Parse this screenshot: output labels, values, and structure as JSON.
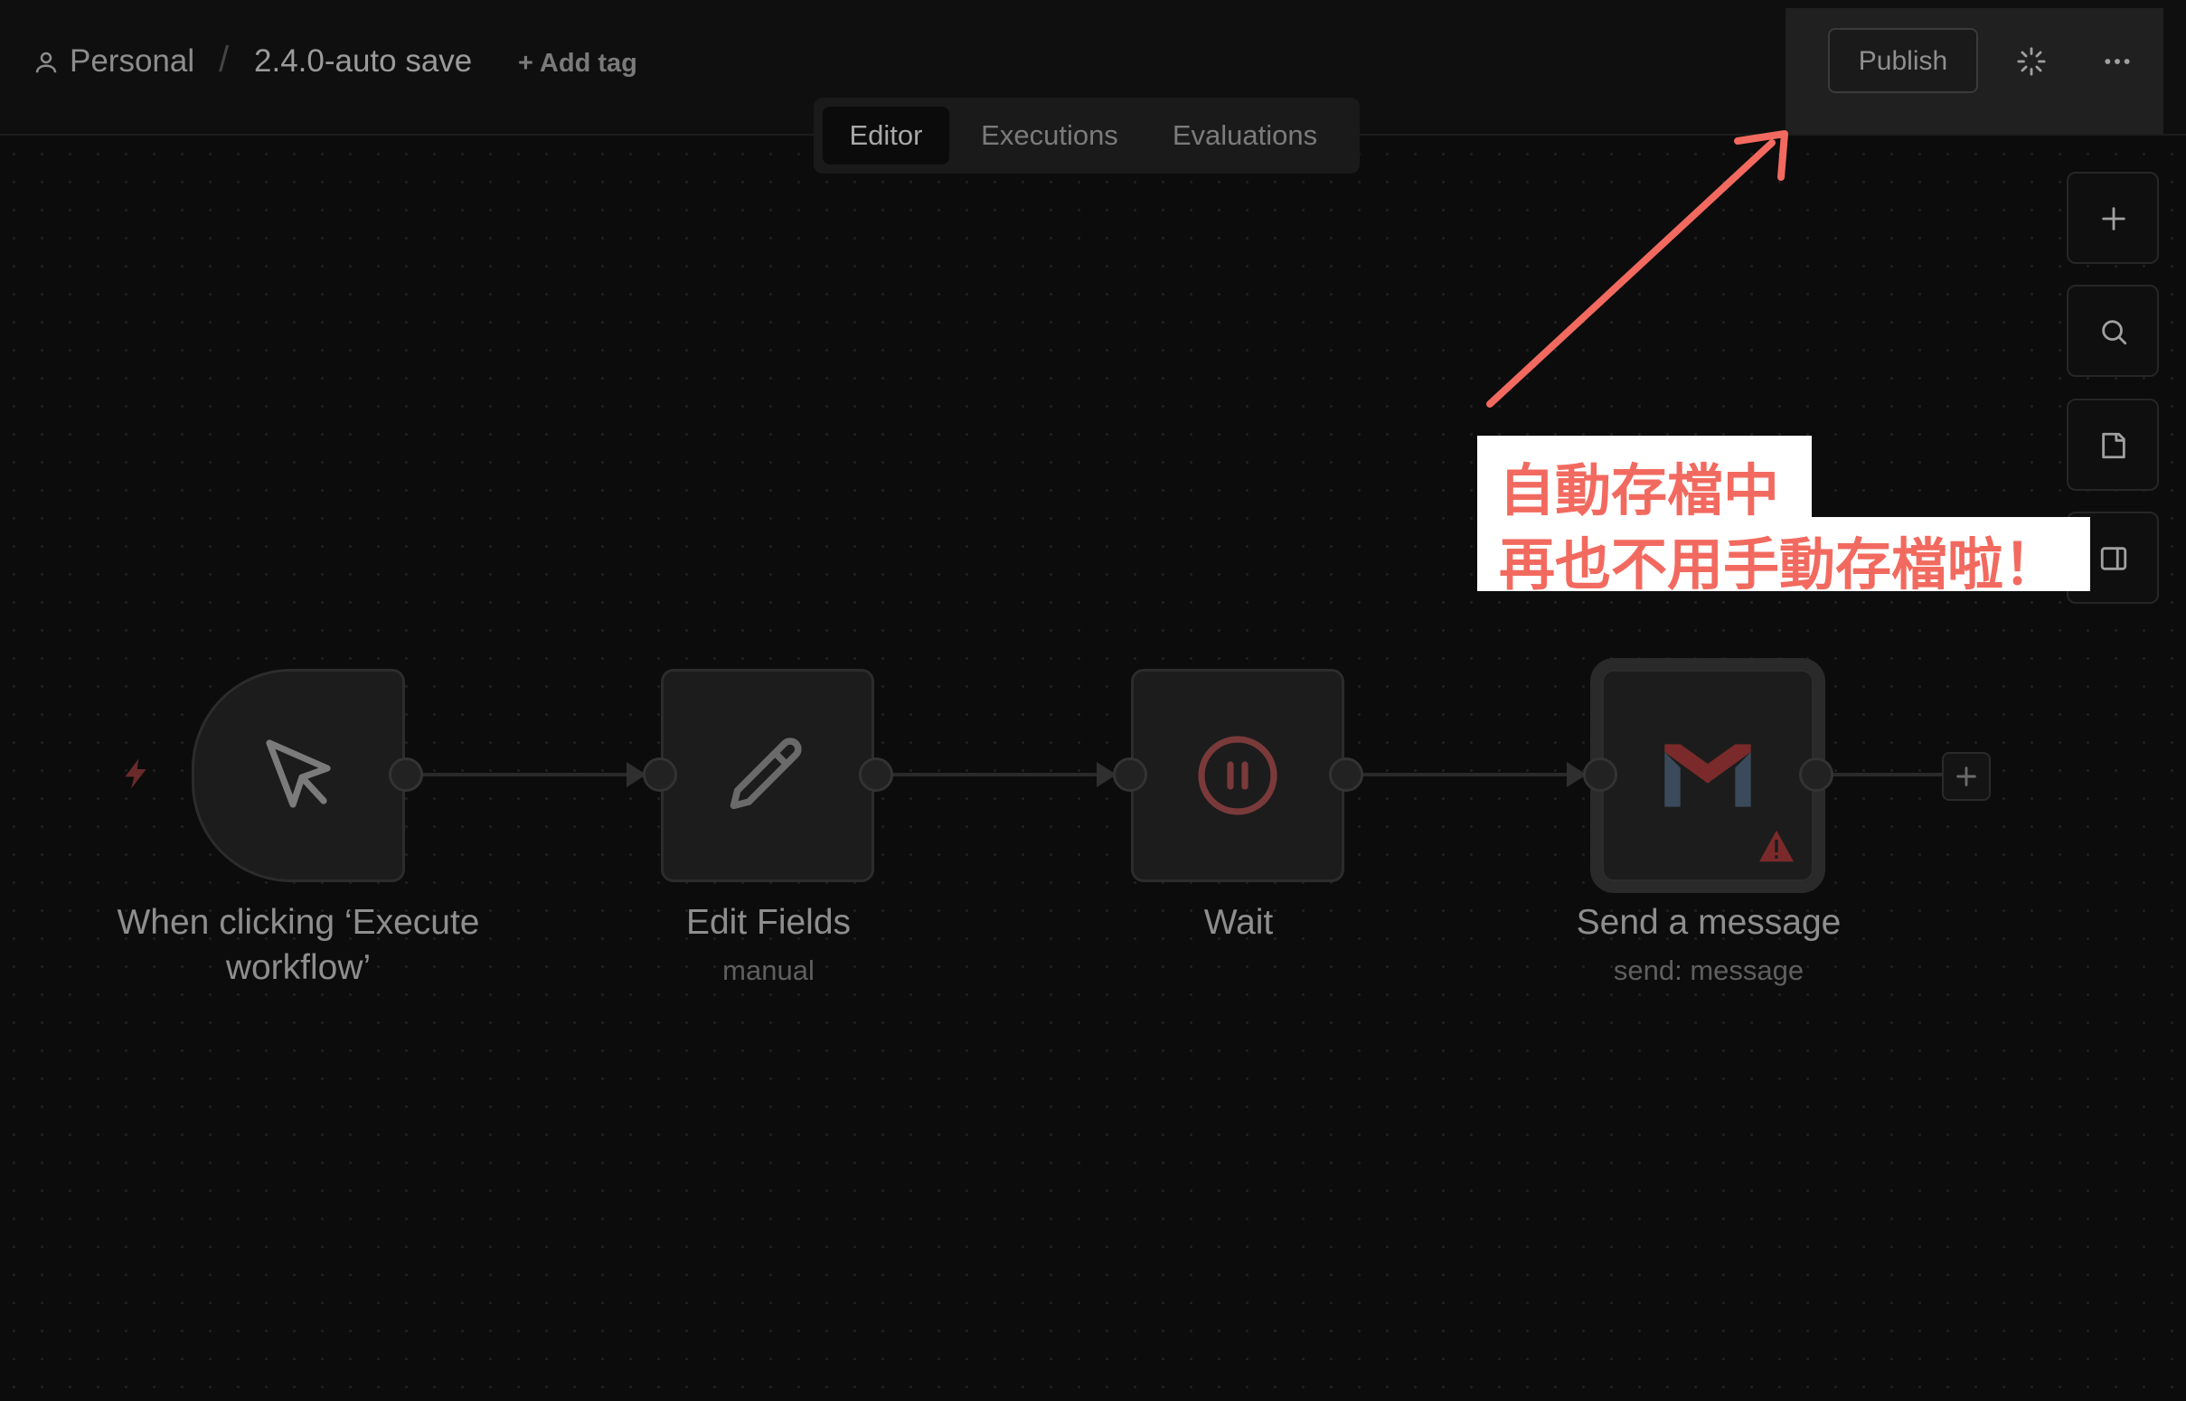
{
  "header": {
    "project": "Personal",
    "separator": "/",
    "workflow_name": "2.4.0-auto save",
    "add_tag": "+ Add tag",
    "publish_label": "Publish",
    "status_icon": "loading-spinner-icon",
    "more_icon": "ellipsis-icon"
  },
  "tabs": [
    {
      "label": "Editor",
      "active": true
    },
    {
      "label": "Executions",
      "active": false
    },
    {
      "label": "Evaluations",
      "active": false
    }
  ],
  "side_toolbar": [
    "plus-icon",
    "search-icon",
    "sticky-note-icon",
    "panel-icon"
  ],
  "nodes": [
    {
      "title": "When clicking ‘Execute workflow’",
      "subtitle": "",
      "icon": "cursor-icon",
      "trigger": true
    },
    {
      "title": "Edit Fields",
      "subtitle": "manual",
      "icon": "pencil-icon"
    },
    {
      "title": "Wait",
      "subtitle": "",
      "icon": "pause-icon"
    },
    {
      "title": "Send a message",
      "subtitle": "send: message",
      "icon": "gmail-icon",
      "warning": true
    }
  ],
  "annotation": {
    "line1": "自動存檔中",
    "line2": "再也不用手動存檔啦！",
    "color": "#f26a5f"
  }
}
